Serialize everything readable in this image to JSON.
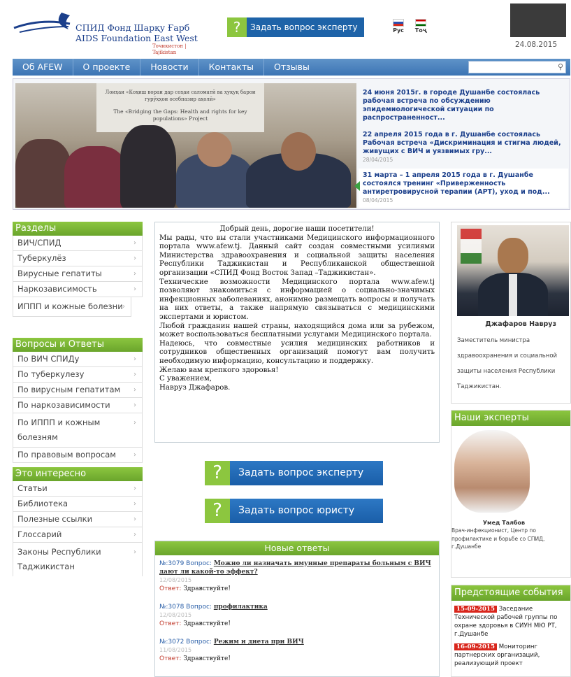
{
  "header": {
    "logo_line1": "СПИД Фонд Шарқу Ғарб",
    "logo_line2": "AIDS Foundation East West",
    "logo_line3": "Точикистон | Tajikistan",
    "ask_label": "Задать вопрос эксперту",
    "lang_ru": "Рус",
    "lang_tj": "Тоҷ",
    "date": "24.08.2015"
  },
  "nav": {
    "items": [
      "Об AFEW",
      "О проекте",
      "Новости",
      "Контакты",
      "Отзывы"
    ]
  },
  "slider": {
    "banner_line1": "Лоиҳаи «Коҳиш вораи дар соҳаи саломатӣ ва ҳуқуқ барои гурӯҳҳои осебпазир аҳолӣ»",
    "banner_line2": "The «Bridging the Gaps: Health and rights for key populations» Project",
    "news": [
      {
        "title": "24 июня 2015г. в городе Душанбе состоялась рабочая встреча по обсуждению эпидемиологической ситуации по распространенност...",
        "date": ""
      },
      {
        "title": "22 апреля 2015 года в г. Душанбе состоялась Рабочая встреча «Дискриминация и стигма людей, живущих с ВИЧ и уязвимых гру...",
        "date": "28/04/2015"
      },
      {
        "title": "31 марта – 1 апреля 2015 года в г. Душанбе состоялся тренинг «Приверженность антиретровирусной терапии (АРТ), уход и под...",
        "date": "08/04/2015"
      }
    ]
  },
  "sidebar": {
    "sections_head": "Разделы",
    "sections": [
      "ВИЧ/СПИД",
      "Туберкулёз",
      "Вирусные гепатиты",
      "Наркозависимость",
      "ИППП и кожные болезни"
    ],
    "qa_head": "Вопросы и Ответы",
    "qa": [
      "По ВИЧ СПИДу",
      "По туберкулезу",
      "По вирусным гепатитам",
      "По наркозависимости",
      "По ИППП и кожным болезням",
      "По правовым вопросам"
    ],
    "interesting_head": "Это интересно",
    "interesting": [
      "Статьи",
      "Библиотека",
      "Полезные ссылки",
      "Глоссарий",
      "Законы Республики Таджикистан"
    ]
  },
  "welcome": {
    "title": "Добрый день, дорогие наши посетители!",
    "p1": "Мы рады, что вы стали участниками Медицинского информационного портала www.afew.tj. Данный сайт создан совместными усилиями Министерства здравоохранения и социальной защиты населения Республики Таджикистан и Республиканской общественной организации «СПИД Фонд Восток Запад –Таджикистан».",
    "p2": "Технические возможности Медицинского портала www.afew.tj позволяют знакомиться с информацией о социально-значимых инфекционных заболеваниях, анонимно размещать вопросы и получать на них ответы, а также напрямую связываться с медицинскими экспертами и юристом.",
    "p3": "Любой гражданин нашей страны, находящийся дома или за рубежом, может воспользоваться бесплатными услугами Медицинского портала.",
    "p4": "Надеюсь, что совместные усилия медицинских работников и сотрудников общественных организаций помогут вам получить необходимую информацию, консультацию и поддержку.",
    "p5": "Желаю вам крепкого здоровья!",
    "p6": "С уважением,",
    "p7": "Навруз Джафаров."
  },
  "buttons": {
    "ask_expert": "Задать вопрос эксперту",
    "ask_lawyer": "Задать вопрос юристу"
  },
  "answers": {
    "head": "Новые ответы",
    "q_label": "Вопрос:",
    "a_label": "Ответ:",
    "items": [
      {
        "num": "№:3079",
        "question": "Можно ли назначать имунные препараты больным с ВИЧ дают ли какой-то эффект?",
        "date": "12/08/2015",
        "answer": "Здравствуйте!"
      },
      {
        "num": "№:3078",
        "question": "профилактика",
        "date": "12/08/2015",
        "answer": "Здравствуйте!"
      },
      {
        "num": "№:3072",
        "question": "Режим и диета при ВИЧ",
        "date": "11/08/2015",
        "answer": "Здравствуйте!"
      }
    ]
  },
  "minister": {
    "name": "Джафаров Навруз",
    "desc": "Заместитель министра здравоохранения и социальной защиты населения Республики Таджикистан."
  },
  "experts": {
    "head": "Наши эксперты",
    "name": "Умед Талбов",
    "desc": "Врач-инфекционист, Центр по профилактике и борьбе со СПИД, г.Душанбе"
  },
  "events": {
    "head": "Предстоящие события",
    "items": [
      {
        "date": "15-09-2015",
        "text": "Заседание Технической рабочей группы по охране здоровья в СИУН МЮ РТ, г.Душанбе"
      },
      {
        "date": "16-09-2015",
        "text": "Мониторинг партнерских организаций, реализующий проект"
      }
    ]
  }
}
